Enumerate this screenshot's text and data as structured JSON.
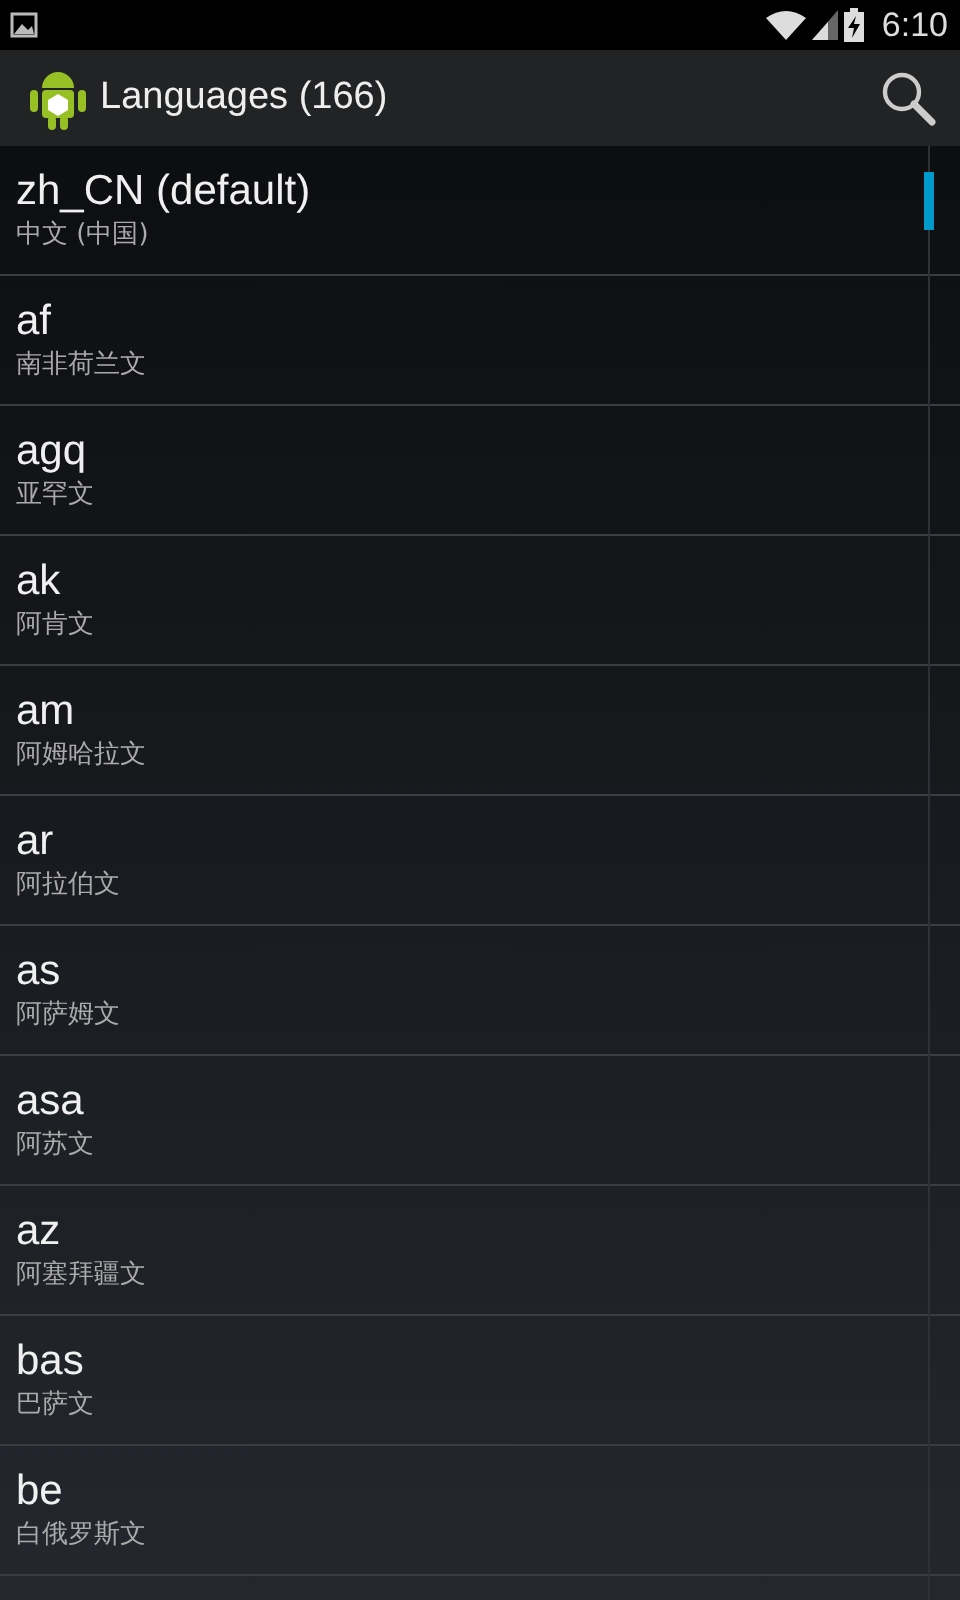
{
  "status_bar": {
    "time": "6:10"
  },
  "action_bar": {
    "title": "Languages (166)"
  },
  "languages": [
    {
      "code": "zh_CN (default)",
      "name": "中文 (中国)"
    },
    {
      "code": "af",
      "name": "南非荷兰文"
    },
    {
      "code": "agq",
      "name": "亚罕文"
    },
    {
      "code": "ak",
      "name": "阿肯文"
    },
    {
      "code": "am",
      "name": "阿姆哈拉文"
    },
    {
      "code": "ar",
      "name": "阿拉伯文"
    },
    {
      "code": "as",
      "name": "阿萨姆文"
    },
    {
      "code": "asa",
      "name": "阿苏文"
    },
    {
      "code": "az",
      "name": "阿塞拜疆文"
    },
    {
      "code": "bas",
      "name": "巴萨文"
    },
    {
      "code": "be",
      "name": "白俄罗斯文"
    }
  ]
}
